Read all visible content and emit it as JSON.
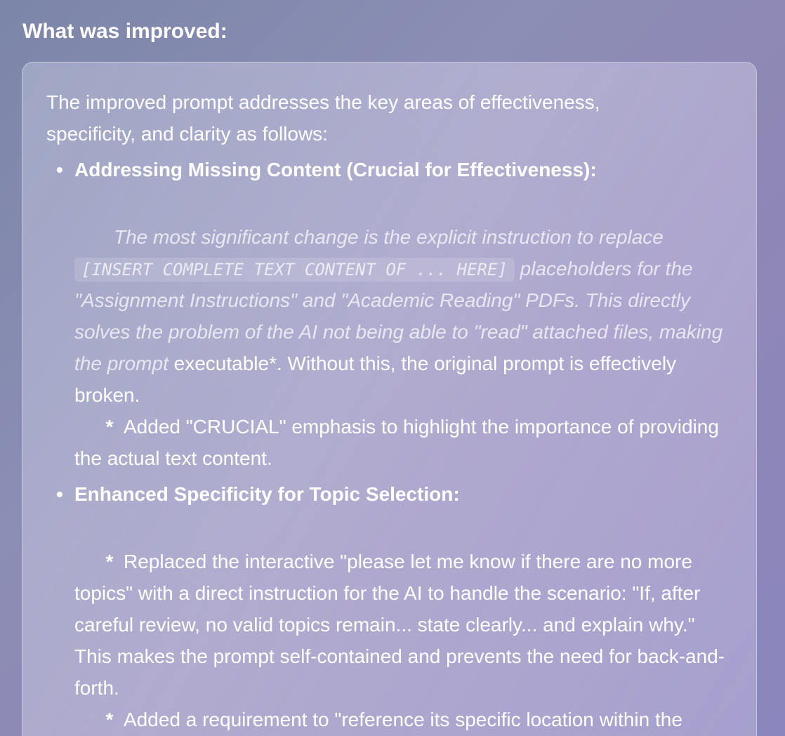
{
  "section": {
    "heading": "What was improved:"
  },
  "card": {
    "intro": "The improved prompt addresses the key areas of effectiveness, specificity, and clarity as follows:",
    "bullets": [
      {
        "title": "Addressing Missing Content (Crucial for Effectiveness):",
        "para_italic_1": "The most significant change is the explicit instruction to replace",
        "code": "[INSERT COMPLETE TEXT CONTENT OF ... HERE]",
        "para_italic_2": "placeholders for the \"Assignment Instructions\" and \"Academic Reading\" PDFs. This directly solves the problem of the AI not being able to \"read\" attached files, making the prompt",
        "para_normal": "executable*. Without this, the original prompt is effectively broken.",
        "sub_star": "*",
        "sub_text": "Added \"CRUCIAL\" emphasis to highlight the importance of providing the actual text content."
      },
      {
        "title": "Enhanced Specificity for Topic Selection:",
        "sub1_star": "*",
        "sub1_text": "Replaced the interactive \"please let me know if there are no more topics\" with a direct instruction for the AI to handle the scenario: \"If, after careful review, no valid topics remain... state clearly... and explain why.\" This makes the prompt self-contained and prevents the need for back-and-forth.",
        "sub2_star": "*",
        "sub2_text": "Added a requirement to \"reference its specific location within the"
      }
    ]
  }
}
